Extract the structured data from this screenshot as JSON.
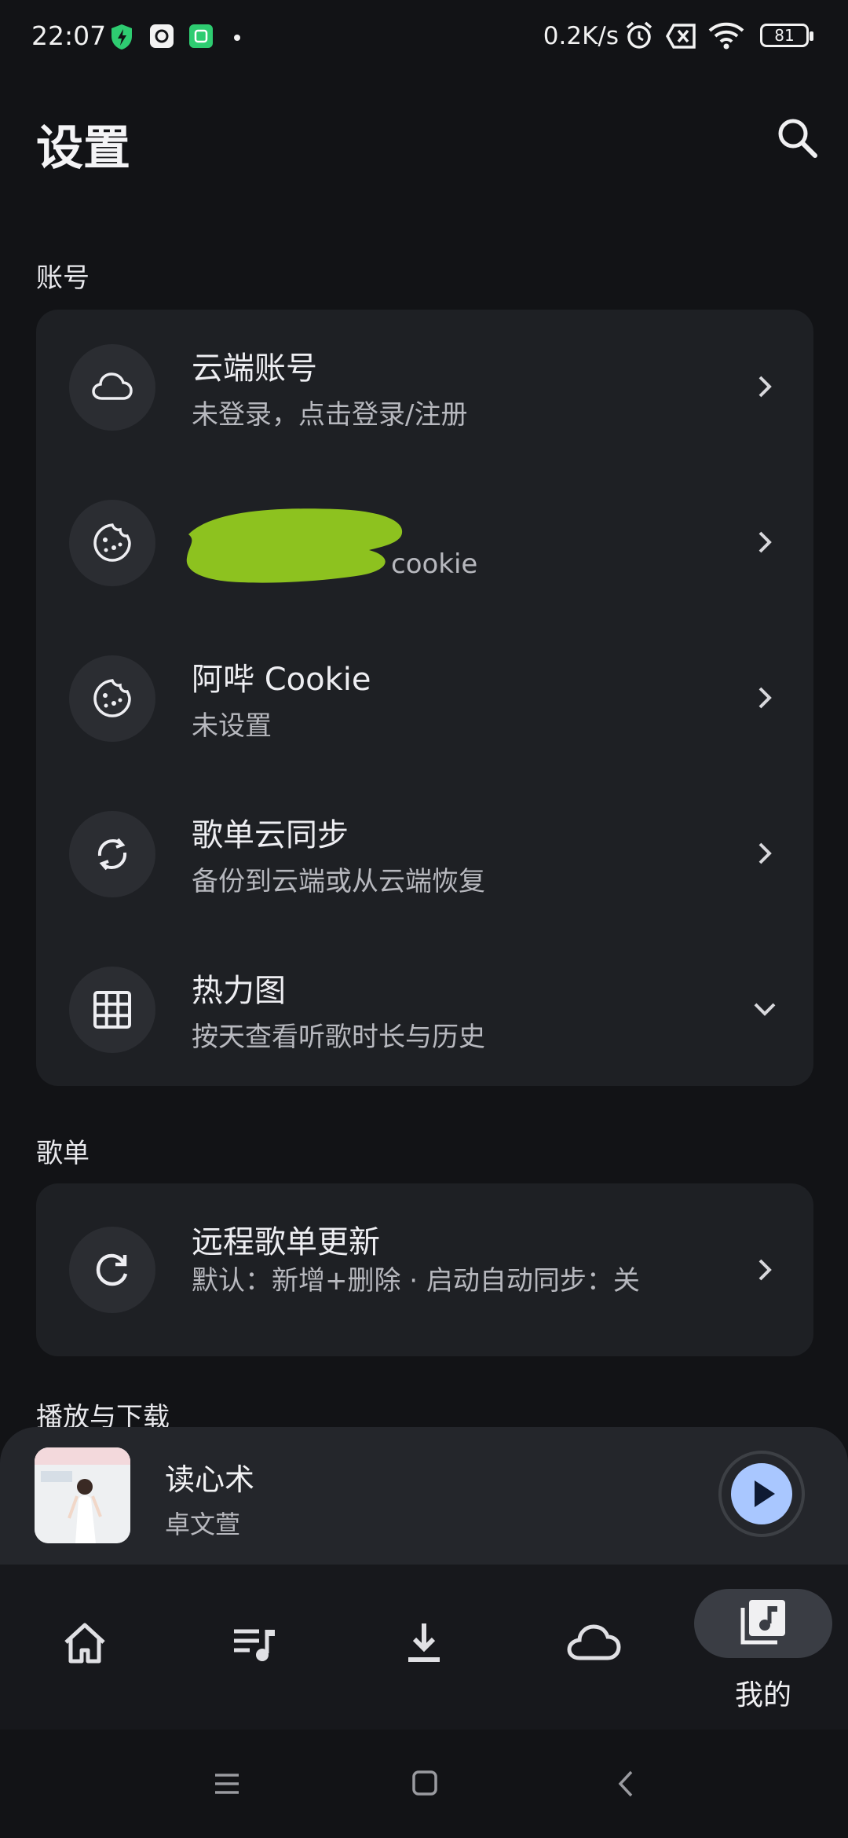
{
  "status_bar": {
    "time": "22:07",
    "net_speed": "0.2K/s",
    "battery": "81",
    "icons": [
      "shield-bolt-icon",
      "app-notification-icon",
      "app-notification-icon-2",
      "dot-icon",
      "alarm-icon",
      "sim-off-icon",
      "wifi-icon",
      "battery-icon"
    ]
  },
  "header": {
    "title": "设置",
    "search_icon": "search-icon"
  },
  "sections": {
    "account": {
      "label": "账号"
    },
    "playlist": {
      "label": "歌单"
    },
    "playback": {
      "label": "播放与下载"
    }
  },
  "account_rows": [
    {
      "title": "云端账号",
      "subtitle": "未登录，点击登录/注册",
      "icon": "cloud-icon",
      "trailing": "chevron-right"
    },
    {
      "title": "",
      "subtitle": "cookie",
      "icon": "cookie-icon",
      "trailing": "chevron-right"
    },
    {
      "title": "阿哔 Cookie",
      "subtitle": "未设置",
      "icon": "cookie-icon",
      "trailing": "chevron-right"
    },
    {
      "title": "歌单云同步",
      "subtitle": "备份到云端或从云端恢复",
      "icon": "sync-icon",
      "trailing": "chevron-right"
    },
    {
      "title": "热力图",
      "subtitle": "按天查看听歌时长与历史",
      "icon": "grid-icon",
      "trailing": "chevron-down"
    }
  ],
  "playlist_rows": [
    {
      "title": "远程歌单更新",
      "subtitle": "默认：新增+删除 · 启动自动同步：关",
      "icon": "refresh-icon",
      "trailing": "chevron-right"
    }
  ],
  "mini_player": {
    "song": "读心术",
    "artist": "卓文萱",
    "play_icon": "play-icon"
  },
  "bottom_nav": {
    "items": [
      {
        "icon": "home-icon"
      },
      {
        "icon": "playlist-icon"
      },
      {
        "icon": "download-icon"
      },
      {
        "icon": "cloud-icon"
      },
      {
        "icon": "library-icon",
        "label": "我的",
        "active": true
      }
    ]
  },
  "colors": {
    "background": "#121316",
    "card": "#1e2024",
    "accent": "#a9c7ff",
    "redaction": "#8dc21f"
  }
}
